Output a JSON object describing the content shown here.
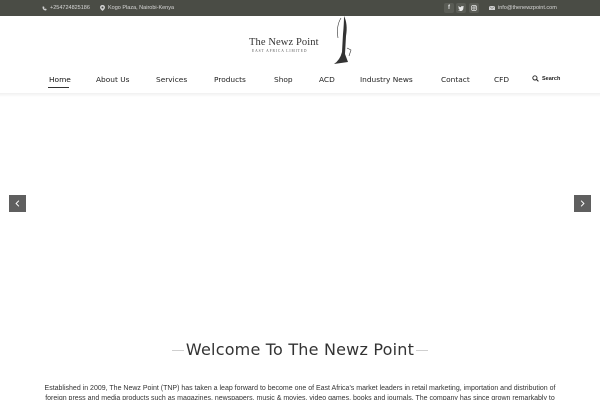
{
  "topbar": {
    "phone": "+254724825186",
    "address": "Kogo Plaza, Nairobi-Kenya",
    "email": "info@thenewzpoint.com",
    "social": [
      "facebook-icon",
      "twitter-icon",
      "instagram-icon"
    ]
  },
  "logo": {
    "name": "The Newz Point",
    "subtitle": "EAST AFRICA LIMITED"
  },
  "nav": {
    "items": [
      "Home",
      "About Us",
      "Services",
      "Products",
      "Shop",
      "ACD",
      "Industry News",
      "Contact",
      "CFD"
    ],
    "active": "Home",
    "search_label": "Search"
  },
  "welcome": {
    "title": "Welcome To The Newz Point",
    "intro": "Established in 2009, The Newz Point (TNP) has taken a leap forward to become one of East Africa's market leaders in retail marketing, importation and distribution of foreign press and media products such as magazines, newspapers, music & movies, video games, books and journals. The company has since grown remarkably to"
  },
  "colors": {
    "topbar_bg": "#4a4c45",
    "arrow_bg": "#5f5f5f"
  }
}
